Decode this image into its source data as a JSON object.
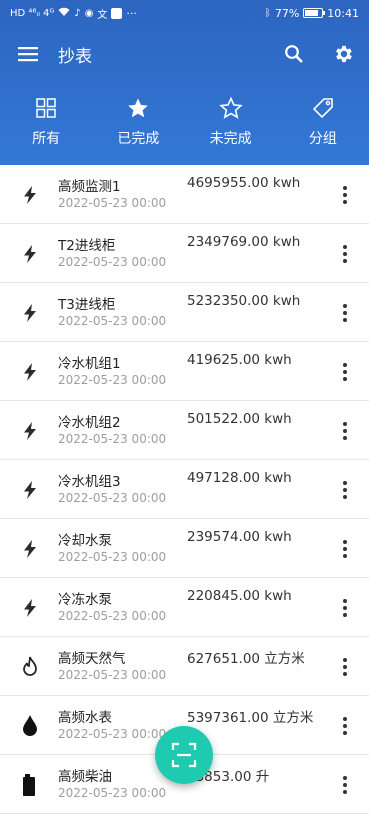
{
  "status_bar": {
    "left_indicators": "HD ⁴⁶ᵢₗ 4ᴳ",
    "battery": "77%",
    "battery_level": 0.77,
    "time": "10:41"
  },
  "toolbar": {
    "title": "抄表"
  },
  "filters": [
    {
      "label": "所有",
      "icon": "grid-icon"
    },
    {
      "label": "已完成",
      "icon": "star-filled-icon"
    },
    {
      "label": "未完成",
      "icon": "star-outline-icon"
    },
    {
      "label": "分组",
      "icon": "tag-icon"
    }
  ],
  "meters": [
    {
      "name": "高频监测1",
      "date": "2022-05-23 00:00",
      "value": "4695955.00 kwh",
      "icon": "lightning-icon"
    },
    {
      "name": "T2进线柜",
      "date": "2022-05-23 00:00",
      "value": "2349769.00 kwh",
      "icon": "lightning-icon"
    },
    {
      "name": "T3进线柜",
      "date": "2022-05-23 00:00",
      "value": "5232350.00 kwh",
      "icon": "lightning-icon"
    },
    {
      "name": "冷水机组1",
      "date": "2022-05-23 00:00",
      "value": "419625.00 kwh",
      "icon": "lightning-icon"
    },
    {
      "name": "冷水机组2",
      "date": "2022-05-23 00:00",
      "value": "501522.00 kwh",
      "icon": "lightning-icon"
    },
    {
      "name": "冷水机组3",
      "date": "2022-05-23 00:00",
      "value": "497128.00 kwh",
      "icon": "lightning-icon"
    },
    {
      "name": "冷却水泵",
      "date": "2022-05-23 00:00",
      "value": "239574.00 kwh",
      "icon": "lightning-icon"
    },
    {
      "name": "冷冻水泵",
      "date": "2022-05-23 00:00",
      "value": "220845.00 kwh",
      "icon": "lightning-icon"
    },
    {
      "name": "高频天然气",
      "date": "2022-05-23 00:00",
      "value": "627651.00 立方米",
      "icon": "flame-icon"
    },
    {
      "name": "高频水表",
      "date": "2022-05-23 00:00",
      "value": "5397361.00 立方米",
      "icon": "water-drop-icon"
    },
    {
      "name": "高频柴油",
      "date": "2022-05-23 00:00",
      "value": "23853.00 升",
      "icon": "fuel-can-icon"
    }
  ],
  "colors": {
    "header": "#2c65c0",
    "fab": "#1fcbb0",
    "secondary_text": "#9e9e9e"
  }
}
